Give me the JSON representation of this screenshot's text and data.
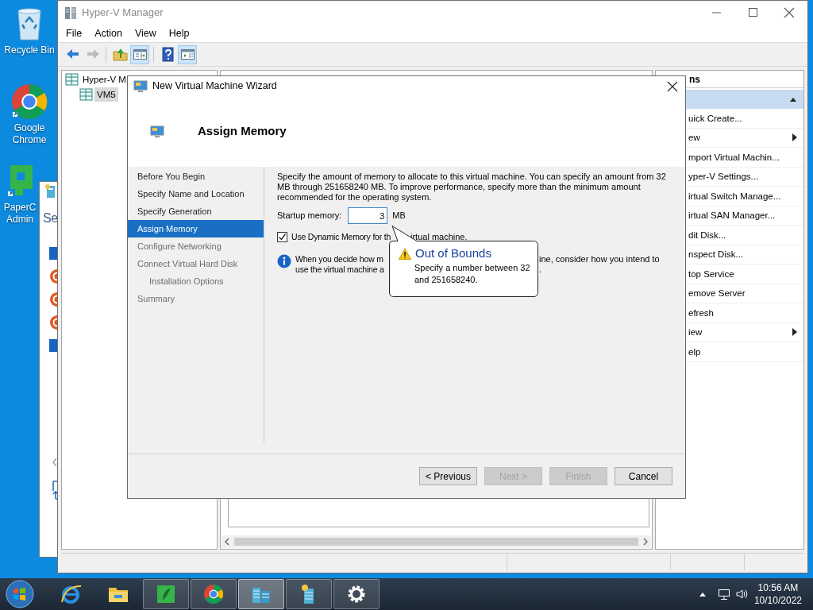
{
  "desktop_icons": [
    {
      "kind": "recycle_bin",
      "lines": [
        "Recycle Bin"
      ]
    },
    {
      "kind": "browser",
      "lines": [
        "Google",
        "Chrome"
      ]
    },
    {
      "kind": "app",
      "lines": [
        "PaperC",
        "Admin"
      ]
    }
  ],
  "background_window": {
    "heading": "Se"
  },
  "hyperv": {
    "title": "Hyper-V Manager",
    "menu": [
      "File",
      "Action",
      "View",
      "Help"
    ],
    "toolbar": [
      {
        "kind": "back",
        "disabled": false,
        "pressed": false
      },
      {
        "kind": "forward",
        "disabled": true,
        "pressed": false
      },
      {
        "kind": "up",
        "disabled": false,
        "pressed": false
      },
      {
        "kind": "tree",
        "disabled": false,
        "pressed": true
      },
      {
        "kind": "help",
        "disabled": false,
        "pressed": false
      },
      {
        "kind": "actions",
        "disabled": false,
        "pressed": true
      }
    ],
    "tree": [
      {
        "label": "Hyper-V M",
        "selected": false,
        "children": [
          {
            "label": "VM5",
            "selected": true
          }
        ]
      }
    ],
    "actions": {
      "header": "ns",
      "items": [
        {
          "label": "uick Create...",
          "submenu": false
        },
        {
          "label": "ew",
          "submenu": true
        },
        {
          "label": "mport Virtual Machin...",
          "submenu": false
        },
        {
          "label": "yper-V Settings...",
          "submenu": false
        },
        {
          "label": "irtual Switch Manage...",
          "submenu": false
        },
        {
          "label": "irtual SAN Manager...",
          "submenu": false
        },
        {
          "label": "dit Disk...",
          "submenu": false
        },
        {
          "label": "nspect Disk...",
          "submenu": false
        },
        {
          "label": "top Service",
          "submenu": false
        },
        {
          "label": "emove Server",
          "submenu": false
        },
        {
          "label": "efresh",
          "submenu": false
        },
        {
          "label": "iew",
          "submenu": true
        },
        {
          "label": "elp",
          "submenu": false
        }
      ]
    }
  },
  "wizard": {
    "title": "New Virtual Machine Wizard",
    "heading": "Assign Memory",
    "steps": [
      {
        "label": "Before You Begin",
        "selected": false,
        "disabled": false
      },
      {
        "label": "Specify Name and Location",
        "selected": false,
        "disabled": false
      },
      {
        "label": "Specify Generation",
        "selected": false,
        "disabled": false
      },
      {
        "label": "Assign Memory",
        "selected": true,
        "disabled": false
      },
      {
        "label": "Configure Networking",
        "selected": false,
        "disabled": true
      },
      {
        "label": "Connect Virtual Hard Disk",
        "selected": false,
        "disabled": true,
        "children": [
          {
            "label": "Installation Options",
            "selected": false,
            "disabled": true
          }
        ]
      },
      {
        "label": "Summary",
        "selected": false,
        "disabled": true
      }
    ],
    "description": "Specify the amount of memory to allocate to this virtual machine. You can specify an amount from 32 MB through 251658240 MB. To improve performance, specify more than the minimum amount recommended for the operating system.",
    "startup_memory": {
      "label": "Startup memory:",
      "value": "3",
      "unit": "MB"
    },
    "dynamic_memory": {
      "checked": true,
      "parts": [
        "Use Dynamic Memory for th",
        "irtual machine."
      ]
    },
    "info_lines": [
      {
        "before": "When you decide how m",
        "after": "ine, consider how you intend to"
      },
      {
        "before": "use the virtual machine a",
        "after": "."
      }
    ],
    "balloon": {
      "title": "Out of Bounds",
      "message": "Specify a number between 32 and 251658240."
    },
    "buttons": [
      {
        "label": "< Previous",
        "disabled": false
      },
      {
        "label": "Next >",
        "disabled": true
      },
      {
        "label": "Finish",
        "disabled": true
      },
      {
        "label": "Cancel",
        "disabled": false
      }
    ]
  },
  "taskbar": {
    "apps": [
      {
        "kind": "ie",
        "running": false,
        "active": false
      },
      {
        "kind": "folder",
        "running": false,
        "active": false
      },
      {
        "kind": "app",
        "running": true,
        "active": false
      },
      {
        "kind": "browser",
        "running": true,
        "active": false
      },
      {
        "kind": "server",
        "running": true,
        "active": true
      },
      {
        "kind": "server_star",
        "running": true,
        "active": false
      },
      {
        "kind": "gear",
        "running": true,
        "active": false
      }
    ],
    "clock": {
      "time": "10:56 AM",
      "date": "10/10/2022"
    }
  }
}
